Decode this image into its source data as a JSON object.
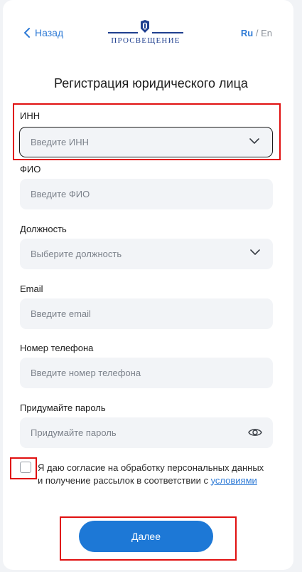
{
  "header": {
    "back_label": "Назад",
    "logo_text": "ПРОСВЕЩЕНИЕ",
    "lang_active": "Ru",
    "lang_separator": " / ",
    "lang_other": "En"
  },
  "title": "Регистрация юридического лица",
  "fields": {
    "inn": {
      "label": "ИНН",
      "placeholder": "Введите ИНН"
    },
    "fio": {
      "label": "ФИО",
      "placeholder": "Введите ФИО"
    },
    "position": {
      "label": "Должность",
      "placeholder": "Выберите должность"
    },
    "email": {
      "label": "Email",
      "placeholder": "Введите email"
    },
    "phone": {
      "label": "Номер телефона",
      "placeholder": "Введите номер телефона"
    },
    "password": {
      "label": "Придумайте пароль",
      "placeholder": "Придумайте пароль"
    }
  },
  "consent": {
    "text": "Я даю согласие на обработку персональных данных и получение рассылок в соответствии с ",
    "link": "условиями"
  },
  "submit_label": "Далее",
  "colors": {
    "accent": "#1d78d6",
    "highlight": "#e01010",
    "input_bg": "#f2f4f7"
  }
}
